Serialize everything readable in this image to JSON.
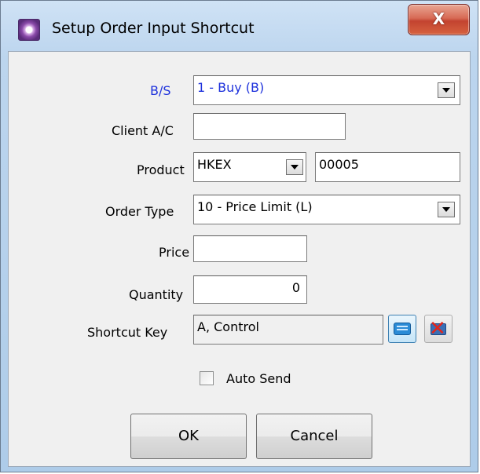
{
  "window": {
    "title": "Setup Order Input Shortcut",
    "close_label": "X"
  },
  "form": {
    "bs": {
      "label": "B/S",
      "value": "1 - Buy (B)"
    },
    "client_ac": {
      "label": "Client A/C",
      "value": ""
    },
    "product": {
      "label": "Product",
      "exchange": "HKEX",
      "code": "00005"
    },
    "order_type": {
      "label": "Order Type",
      "value": "10 - Price Limit (L)"
    },
    "price": {
      "label": "Price",
      "value": ""
    },
    "quantity": {
      "label": "Quantity",
      "value": "0"
    },
    "shortcut_key": {
      "label": "Shortcut Key",
      "value": "A, Control"
    },
    "auto_send": {
      "label": "Auto Send",
      "checked": false
    }
  },
  "buttons": {
    "ok": "OK",
    "cancel": "Cancel"
  },
  "icons": {
    "app": "app-icon",
    "keyboard": "keyboard-icon",
    "clear": "clear-shortcut-icon"
  }
}
